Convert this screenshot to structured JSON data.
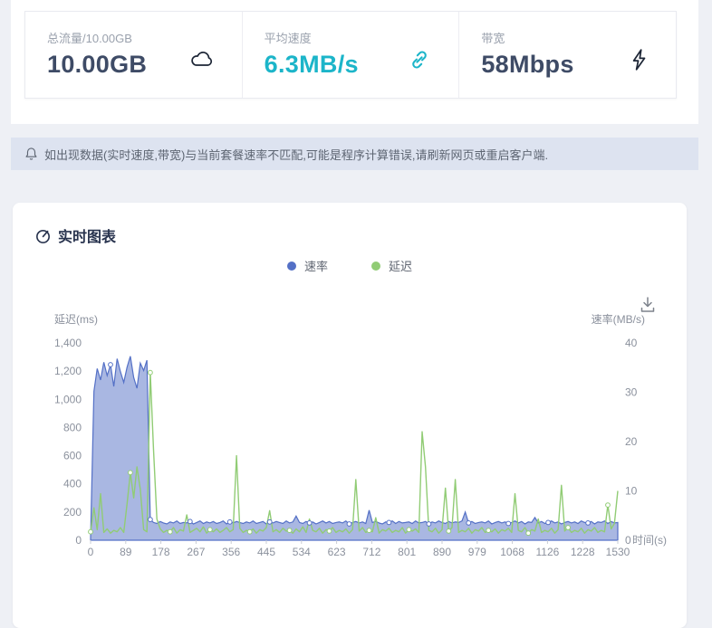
{
  "stats_cards": [
    {
      "label": "总流量/10.00GB",
      "value": "10.00GB",
      "value_color": "#3e4b66",
      "icon": "cloud-icon",
      "icon_color": "#1d2636"
    },
    {
      "label": "平均速度",
      "value": "6.3MB/s",
      "value_color": "#1cb5c9",
      "icon": "link-icon",
      "icon_color": "#1cb5c9"
    },
    {
      "label": "带宽",
      "value": "58Mbps",
      "value_color": "#3e4b66",
      "icon": "bolt-icon",
      "icon_color": "#1d2636"
    }
  ],
  "notice": {
    "text": "如出现数据(实时速度,带宽)与当前套餐速率不匹配,可能是程序计算错误,请刷新网页或重启客户端."
  },
  "chart_card": {
    "title": "实时图表",
    "legend": [
      {
        "label": "速率",
        "color": "#5470c6"
      },
      {
        "label": "延迟",
        "color": "#91cc75"
      }
    ]
  },
  "chart_data": {
    "type": "line",
    "title": "实时图表",
    "legend_position": "top-center",
    "grid": false,
    "x_axis": {
      "name": "时间(s)",
      "tick_labels": [
        "0",
        "89",
        "178",
        "267",
        "356",
        "445",
        "534",
        "623",
        "712",
        "801",
        "890",
        "979",
        "1068",
        "1126",
        "1228",
        "1530"
      ]
    },
    "y_axis_left": {
      "name": "延迟(ms)",
      "range": [
        0,
        1400
      ],
      "ticks": [
        "1,400",
        "1,200",
        "1,000",
        "800",
        "600",
        "400",
        "200",
        "0"
      ]
    },
    "y_axis_right": {
      "name": "速率(MB/s)",
      "range": [
        0,
        40
      ],
      "ticks": [
        "40",
        "30",
        "20",
        "10",
        "0"
      ]
    },
    "x_start": 0,
    "x_step": 10,
    "series": [
      {
        "name": "速率",
        "axis": "right",
        "type": "area",
        "color": "#5470c6",
        "fill": "rgba(84,112,198,0.5)",
        "values": [
          0.5,
          30.2,
          34.8,
          32.5,
          36.1,
          33.4,
          35.6,
          31.2,
          36.8,
          34.2,
          32.0,
          35.1,
          37.3,
          33.0,
          30.8,
          35.9,
          34.4,
          36.5,
          4.2,
          3.6,
          3.4,
          3.8,
          3.5,
          3.3,
          3.7,
          3.5,
          3.9,
          3.4,
          3.6,
          3.5,
          3.8,
          3.3,
          3.6,
          3.9,
          3.4,
          3.7,
          3.5,
          3.8,
          3.4,
          3.6,
          3.9,
          3.3,
          3.7,
          3.5,
          3.8,
          3.6,
          3.4,
          3.7,
          3.5,
          3.9,
          3.4,
          3.6,
          3.8,
          3.3,
          3.7,
          3.5,
          3.8,
          3.6,
          3.4,
          3.9,
          3.5,
          3.7,
          4.9,
          3.6,
          3.4,
          3.8,
          3.5,
          3.7,
          3.3,
          3.6,
          3.9,
          3.5,
          3.8,
          3.4,
          3.6,
          3.7,
          3.5,
          3.9,
          3.3,
          3.6,
          3.8,
          3.5,
          3.7,
          3.4,
          6.1,
          3.6,
          3.8,
          3.5,
          3.3,
          3.7,
          3.6,
          3.9,
          3.4,
          3.8,
          3.5,
          3.6,
          3.7,
          3.4,
          3.9,
          3.5,
          3.6,
          3.8,
          3.3,
          3.7,
          3.5,
          3.9,
          3.6,
          3.4,
          3.8,
          3.5,
          3.7,
          3.6,
          3.9,
          5.7,
          3.5,
          3.8,
          3.4,
          3.6,
          3.7,
          3.5,
          3.9,
          3.3,
          3.6,
          3.8,
          3.5,
          3.7,
          3.4,
          3.6,
          3.9,
          3.5,
          3.8,
          3.3,
          3.7,
          3.6,
          4.6,
          3.5,
          3.8,
          3.4,
          3.6,
          3.9,
          3.5,
          3.7,
          3.3,
          3.6,
          3.8,
          3.5,
          3.7,
          3.4,
          3.9,
          3.6,
          3.5,
          3.8,
          3.3,
          3.7,
          3.6,
          3.9,
          3.4,
          3.8,
          3.5,
          3.6
        ]
      },
      {
        "name": "延迟",
        "axis": "left",
        "type": "line",
        "color": "#91cc75",
        "values": [
          60,
          230,
          75,
          330,
          55,
          80,
          50,
          70,
          60,
          90,
          55,
          260,
          480,
          300,
          520,
          360,
          75,
          60,
          1190,
          640,
          150,
          80,
          55,
          70,
          60,
          90,
          50,
          75,
          65,
          180,
          55,
          70,
          85,
          60,
          95,
          50,
          75,
          60,
          80,
          55,
          70,
          90,
          60,
          75,
          600,
          85,
          55,
          70,
          60,
          80,
          50,
          75,
          65,
          90,
          210,
          60,
          75,
          55,
          85,
          65,
          70,
          50,
          80,
          60,
          95,
          55,
          150,
          70,
          60,
          85,
          50,
          75,
          65,
          90,
          55,
          70,
          60,
          80,
          50,
          75,
          430,
          65,
          90,
          55,
          70,
          60,
          160,
          50,
          75,
          65,
          85,
          55,
          70,
          60,
          90,
          50,
          75,
          65,
          80,
          55,
          770,
          520,
          70,
          60,
          85,
          50,
          75,
          370,
          65,
          90,
          430,
          55,
          70,
          60,
          85,
          50,
          75,
          65,
          90,
          55,
          70,
          60,
          80,
          50,
          75,
          65,
          85,
          55,
          330,
          70,
          60,
          90,
          50,
          75,
          65,
          150,
          55,
          70,
          60,
          85,
          50,
          75,
          390,
          65,
          90,
          55,
          70,
          60,
          85,
          50,
          75,
          65,
          90,
          55,
          70,
          60,
          250,
          80,
          120,
          350
        ]
      }
    ]
  }
}
